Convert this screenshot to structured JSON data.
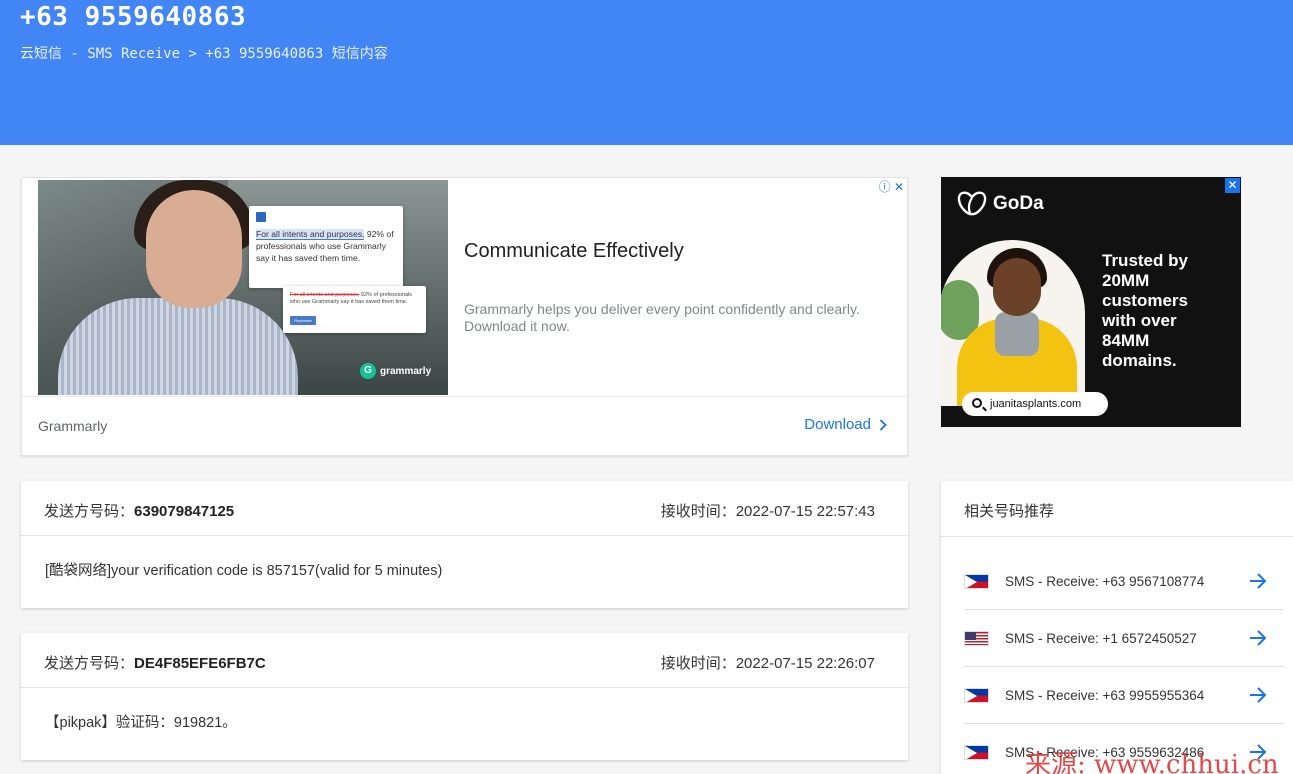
{
  "header": {
    "phone": "+63 9559640863",
    "breadcrumb": "云短信 - SMS Receive > +63 9559640863 短信内容"
  },
  "ad_grammarly": {
    "adchoice": "ⓘ ✕",
    "doc_text_before": "For all intents and purposes,",
    "doc_text_after": "92% of professionals who use Grammarly say it has saved them time.",
    "doc2_strike": "For all intents and purposes,",
    "doc2_text": " 92% of professionals who use Grammarly say it has saved them time.",
    "doc2_button": "Rephrase",
    "badge": "grammarly",
    "headline": "Communicate Effectively",
    "description": "Grammarly helps you deliver every point confidently and clearly. Download it now.",
    "advertiser": "Grammarly",
    "cta": "Download"
  },
  "ad_godaddy": {
    "logo": "GoDa",
    "tagline": "Trusted by 20MM customers with over 84MM domains.",
    "search_text": "juanitasplants.com",
    "close": "✕"
  },
  "messages": [
    {
      "sender_label": "发送方号码：",
      "sender": "639079847125",
      "time_label": "接收时间：",
      "time": "2022-07-15 22:57:43",
      "content": "[酷袋网络]your verification code is 857157(valid for 5 minutes)"
    },
    {
      "sender_label": "发送方号码：",
      "sender": "DE4F85EFE6FB7C",
      "time_label": "接收时间：",
      "time": "2022-07-15 22:26:07",
      "content": "【pikpak】验证码：919821。"
    }
  ],
  "related": {
    "title": "相关号码推荐",
    "items": [
      {
        "flag": "ph",
        "label": "SMS - Receive: +63 9567108774"
      },
      {
        "flag": "us",
        "label": "SMS - Receive: +1 6572450527"
      },
      {
        "flag": "ph",
        "label": "SMS - Receive: +63 9955955364"
      },
      {
        "flag": "ph",
        "label": "SMS - Receive: +63 9559632486"
      }
    ]
  },
  "watermark": "来源: www.chhui.cn",
  "colors": {
    "header": "#4285f4",
    "link": "#1a73e8",
    "watermark": "#e03b3b"
  }
}
